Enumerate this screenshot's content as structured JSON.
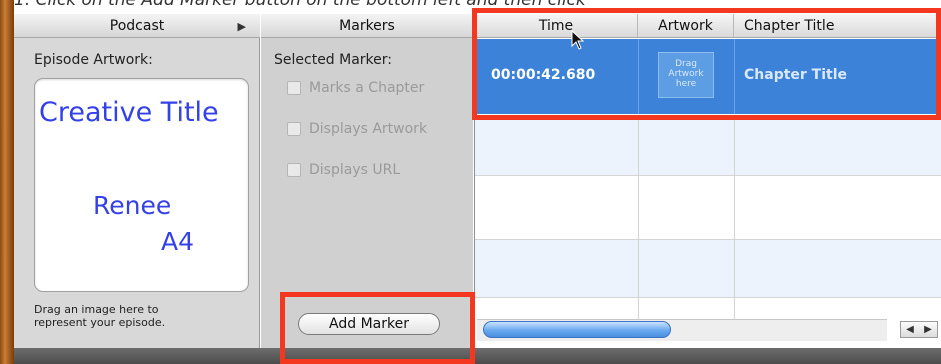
{
  "caption": "1.  Click on the Add Marker button on the bottom left and then click",
  "podcast_panel": {
    "header": "Podcast",
    "episode_artwork_label": "Episode Artwork:",
    "artwork": {
      "title": "Creative Title",
      "line1": "Renee",
      "line2": "A4",
      "text_color": "#3440e8"
    },
    "drag_hint_line1": "Drag an image here to",
    "drag_hint_line2": "represent your episode."
  },
  "markers_panel": {
    "header": "Markers",
    "selected_marker_label": "Selected Marker:",
    "options": [
      {
        "label": "Marks a Chapter",
        "checked": false
      },
      {
        "label": "Displays Artwork",
        "checked": false
      },
      {
        "label": "Displays URL",
        "checked": false
      }
    ],
    "add_button_label": "Add Marker"
  },
  "table": {
    "columns": [
      "Time",
      "Artwork",
      "Chapter Title"
    ],
    "selected_row": {
      "time": "00:00:42.680",
      "artwork_placeholder_line1": "Drag",
      "artwork_placeholder_line2": "Artwork",
      "artwork_placeholder_line3": "here",
      "chapter_title": "Chapter Title"
    },
    "selection_color": "#3b82d8"
  },
  "colors": {
    "highlight_box": "#f4371f"
  }
}
